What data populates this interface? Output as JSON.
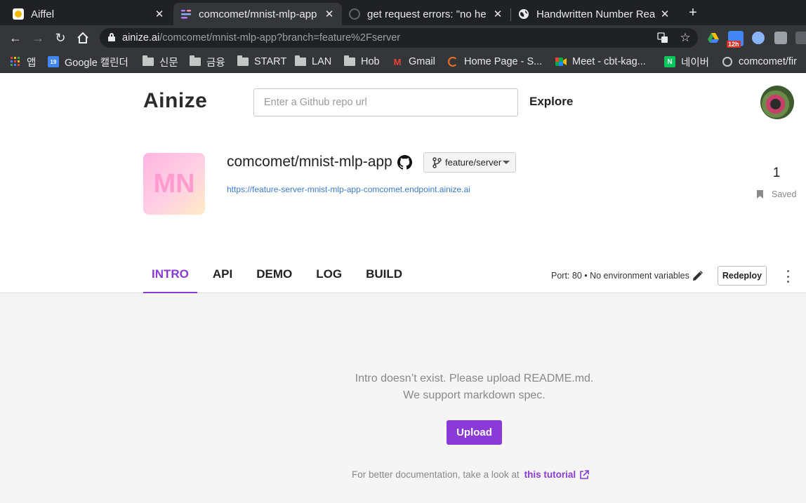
{
  "browser": {
    "tabs": [
      {
        "title": "Aiffel",
        "active": false
      },
      {
        "title": "comcomet/mnist-mlp-app",
        "active": true
      },
      {
        "title": "get request errors: \"no he",
        "active": false
      },
      {
        "title": "Handwritten Number Rea",
        "active": false
      }
    ],
    "new_tab": "+",
    "url_host": "ainize.ai",
    "url_path": "/comcomet/mnist-mlp-app?branch=feature%2Fserver",
    "extension_badge": "12h",
    "bookmarks": [
      {
        "label": "앱",
        "icon": "apps-grid-icon"
      },
      {
        "label": "Google 캘린더",
        "icon": "calendar-icon",
        "icon_text": "19"
      },
      {
        "label": "신문",
        "icon": "folder-icon"
      },
      {
        "label": "금융",
        "icon": "folder-icon"
      },
      {
        "label": "START",
        "icon": "folder-icon"
      },
      {
        "label": "LAN",
        "icon": "folder-icon"
      },
      {
        "label": "Hob",
        "icon": "folder-icon"
      },
      {
        "label": "Gmail",
        "icon": "gmail-icon",
        "icon_text": "M"
      },
      {
        "label": "Home Page - S...",
        "icon": "arc-icon"
      },
      {
        "label": "Meet - cbt-kag...",
        "icon": "meet-icon"
      },
      {
        "label": "네이버",
        "icon": "naver-icon",
        "icon_text": "N"
      },
      {
        "label": "comcomet/fir",
        "icon": "github-icon"
      }
    ]
  },
  "header": {
    "logo": "Ainize",
    "search_placeholder": "Enter a Github repo url",
    "explore": "Explore"
  },
  "app": {
    "avatar_initials": "MN",
    "name": "comcomet/mnist-mlp-app",
    "branch": "feature/server",
    "endpoint": "https://feature-server-mnist-mlp-app-comcomet.endpoint.ainize.ai",
    "saved_count": "1",
    "saved_label": "Saved"
  },
  "tabs": [
    {
      "label": "INTRO",
      "active": true
    },
    {
      "label": "API",
      "active": false
    },
    {
      "label": "DEMO",
      "active": false
    },
    {
      "label": "LOG",
      "active": false
    },
    {
      "label": "BUILD",
      "active": false
    }
  ],
  "config": {
    "port_info": "Port: 80 • No environment variables",
    "redeploy": "Redeploy"
  },
  "intro": {
    "line1": "Intro doesn’t exist. Please upload README.md.",
    "line2": "We support markdown spec.",
    "upload": "Upload",
    "tutorial_prefix": "For better documentation, take a look at",
    "tutorial_link": "this tutorial"
  },
  "colors": {
    "accent": "#8a3ad6",
    "link": "#3b7bd6",
    "chrome_dark": "#202124",
    "chrome_toolbar": "#35363a"
  }
}
